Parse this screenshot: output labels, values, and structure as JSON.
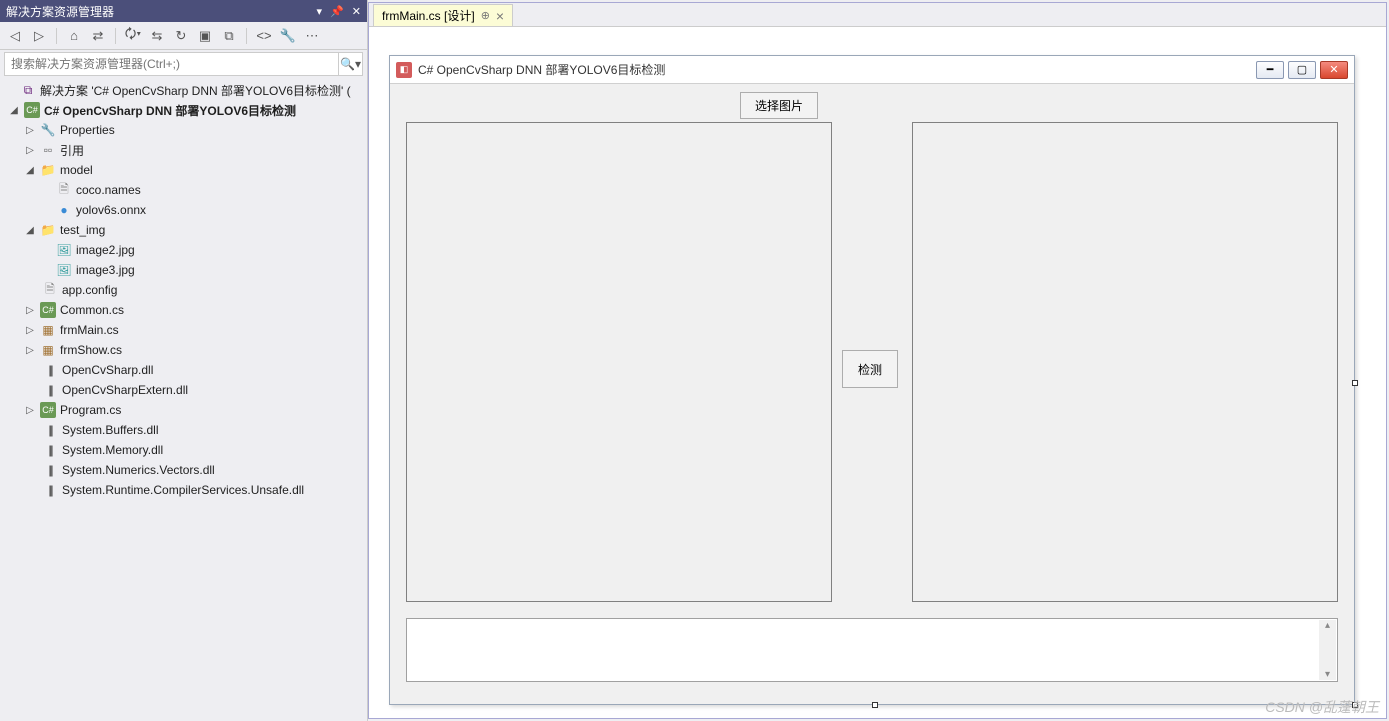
{
  "solutionExplorer": {
    "title": "解决方案资源管理器",
    "searchPlaceholder": "搜索解决方案资源管理器(Ctrl+;)",
    "tree": {
      "solution": "解决方案 'C# OpenCvSharp DNN 部署YOLOV6目标检测' (",
      "project": "C# OpenCvSharp DNN 部署YOLOV6目标检测",
      "properties": "Properties",
      "references": "引用",
      "folder_model": "model",
      "file_coconames": "coco.names",
      "file_onnx": "yolov6s.onnx",
      "folder_testimg": "test_img",
      "file_image2": "image2.jpg",
      "file_image3": "image3.jpg",
      "file_appconfig": "app.config",
      "file_common": "Common.cs",
      "file_frmmain": "frmMain.cs",
      "file_frmshow": "frmShow.cs",
      "file_opencvsharp": "OpenCvSharp.dll",
      "file_opencvsharpextern": "OpenCvSharpExtern.dll",
      "file_program": "Program.cs",
      "file_sysbuffers": "System.Buffers.dll",
      "file_sysmemory": "System.Memory.dll",
      "file_sysnumerics": "System.Numerics.Vectors.dll",
      "file_sysruntime": "System.Runtime.CompilerServices.Unsafe.dll"
    }
  },
  "documentTab": {
    "label": "frmMain.cs [设计]"
  },
  "form": {
    "title": "C# OpenCvSharp DNN 部署YOLOV6目标检测",
    "btn_select_image": "选择图片",
    "btn_detect": "检测"
  },
  "watermark": "CSDN @乱蓬朝王"
}
